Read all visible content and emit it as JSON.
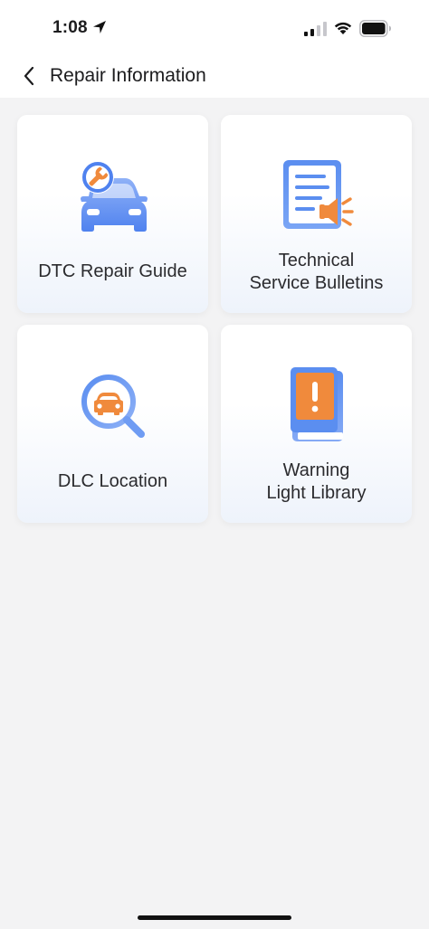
{
  "status_bar": {
    "time": "1:08",
    "icons": [
      "location-arrow-icon",
      "cellular-signal-icon",
      "wifi-icon",
      "battery-icon"
    ]
  },
  "nav": {
    "title": "Repair Information",
    "back_icon": "chevron-left-icon"
  },
  "tiles": [
    {
      "label_lines": [
        "DTC Repair Guide"
      ],
      "icon": "car-wrench-icon"
    },
    {
      "label_lines": [
        "Technical",
        "Service Bulletins"
      ],
      "icon": "document-megaphone-icon"
    },
    {
      "label_lines": [
        "DLC Location"
      ],
      "icon": "magnifier-car-icon"
    },
    {
      "label_lines": [
        "Warning",
        "Light Library"
      ],
      "icon": "warning-book-icon"
    }
  ],
  "colors": {
    "accent_blue": "#5b8ef0",
    "accent_orange": "#f08a3c",
    "background": "#f3f3f4"
  }
}
